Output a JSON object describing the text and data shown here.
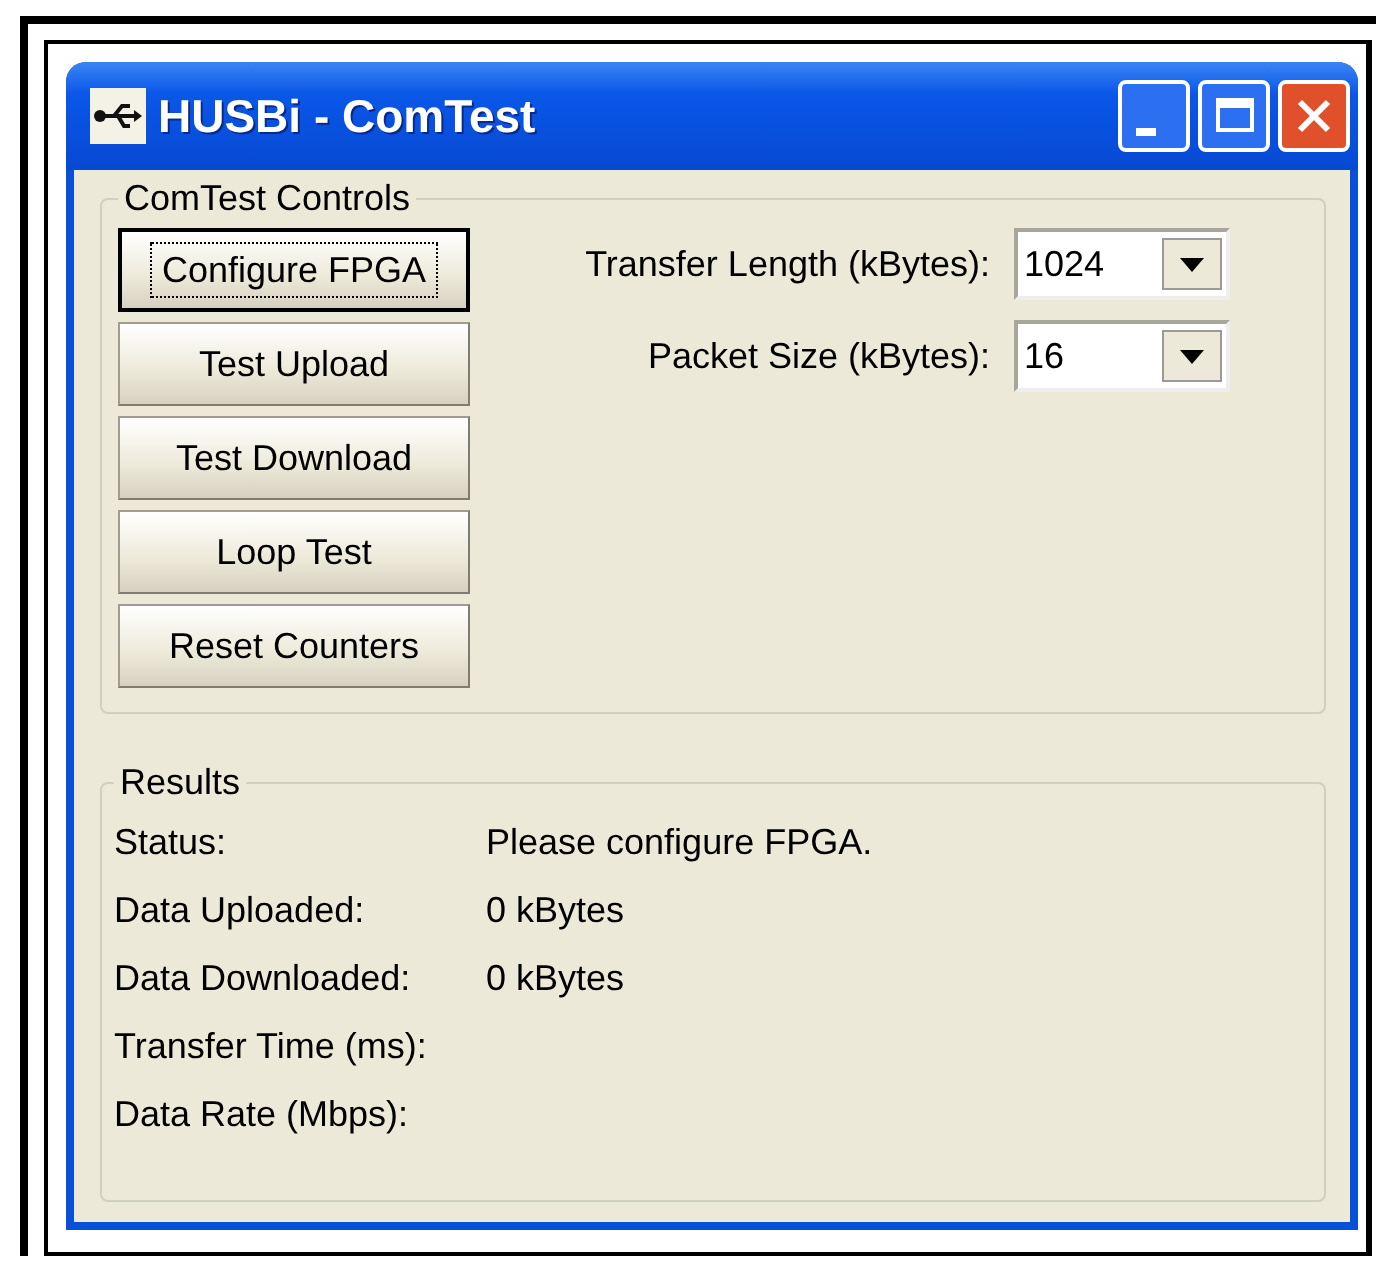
{
  "window": {
    "title": "HUSBi - ComTest"
  },
  "controls": {
    "title": "ComTest Controls",
    "buttons": [
      {
        "label": "Configure FPGA",
        "focused": true
      },
      {
        "label": "Test Upload",
        "focused": false
      },
      {
        "label": "Test Download",
        "focused": false
      },
      {
        "label": "Loop Test",
        "focused": false
      },
      {
        "label": "Reset Counters",
        "focused": false
      }
    ],
    "fields": [
      {
        "label": "Transfer Length (kBytes):",
        "value": "1024"
      },
      {
        "label": "Packet Size (kBytes):",
        "value": "16"
      }
    ]
  },
  "results": {
    "title": "Results",
    "rows": [
      {
        "label": "Status:",
        "value": "Please configure FPGA."
      },
      {
        "label": "Data Uploaded:",
        "value": "0 kBytes"
      },
      {
        "label": "Data Downloaded:",
        "value": "0 kBytes"
      },
      {
        "label": "Transfer Time (ms):"
      },
      {
        "label": "Data Rate (Mbps):"
      }
    ]
  }
}
